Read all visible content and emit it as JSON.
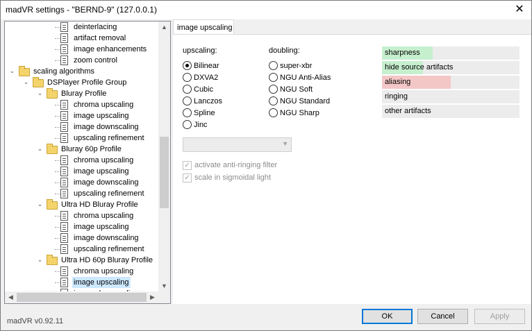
{
  "window": {
    "title": "madVR settings - \"BERND-9\" (127.0.0.1)"
  },
  "tree": {
    "items": [
      {
        "label": "deinterlacing",
        "level": 4,
        "kind": "page"
      },
      {
        "label": "artifact removal",
        "level": 4,
        "kind": "page"
      },
      {
        "label": "image enhancements",
        "level": 4,
        "kind": "page"
      },
      {
        "label": "zoom control",
        "level": 4,
        "kind": "page"
      },
      {
        "label": "scaling algorithms",
        "level": 1,
        "kind": "folder"
      },
      {
        "label": "DSPlayer Profile Group",
        "level": 2,
        "kind": "folder"
      },
      {
        "label": "Bluray Profile",
        "level": 3,
        "kind": "folder"
      },
      {
        "label": "chroma upscaling",
        "level": 4,
        "kind": "page"
      },
      {
        "label": "image upscaling",
        "level": 4,
        "kind": "page"
      },
      {
        "label": "image downscaling",
        "level": 4,
        "kind": "page"
      },
      {
        "label": "upscaling refinement",
        "level": 4,
        "kind": "page"
      },
      {
        "label": "Bluray 60p Profile",
        "level": 3,
        "kind": "folder"
      },
      {
        "label": "chroma upscaling",
        "level": 4,
        "kind": "page"
      },
      {
        "label": "image upscaling",
        "level": 4,
        "kind": "page"
      },
      {
        "label": "image downscaling",
        "level": 4,
        "kind": "page"
      },
      {
        "label": "upscaling refinement",
        "level": 4,
        "kind": "page"
      },
      {
        "label": "Ultra HD Bluray Profile",
        "level": 3,
        "kind": "folder"
      },
      {
        "label": "chroma upscaling",
        "level": 4,
        "kind": "page"
      },
      {
        "label": "image upscaling",
        "level": 4,
        "kind": "page"
      },
      {
        "label": "image downscaling",
        "level": 4,
        "kind": "page"
      },
      {
        "label": "upscaling refinement",
        "level": 4,
        "kind": "page"
      },
      {
        "label": "Ultra HD 60p Bluray Profile",
        "level": 3,
        "kind": "folder"
      },
      {
        "label": "chroma upscaling",
        "level": 4,
        "kind": "page"
      },
      {
        "label": "image upscaling",
        "level": 4,
        "kind": "page",
        "selected": true
      },
      {
        "label": "image downscaling",
        "level": 4,
        "kind": "page"
      }
    ]
  },
  "tab": {
    "label": "image upscaling"
  },
  "upscaling": {
    "label": "upscaling:",
    "options": [
      "Bilinear",
      "DXVA2",
      "Cubic",
      "Lanczos",
      "Spline",
      "Jinc"
    ],
    "selected": "Bilinear"
  },
  "doubling": {
    "label": "doubling:",
    "options": [
      "super-xbr",
      "NGU Anti-Alias",
      "NGU Soft",
      "NGU Standard",
      "NGU Sharp"
    ]
  },
  "filter_combo": {
    "value": ""
  },
  "checkboxes": {
    "anti_ringing": {
      "label": "activate anti-ringing filter",
      "checked": true,
      "enabled": false
    },
    "sigmoidal": {
      "label": "scale in sigmoidal light",
      "checked": true,
      "enabled": false
    }
  },
  "quality_bars": [
    {
      "label": "sharpness",
      "level": 0.37,
      "color": "#c6efce"
    },
    {
      "label": "hide source artifacts",
      "level": 0.3,
      "color": "#c6efce"
    },
    {
      "label": "aliasing",
      "level": 0.5,
      "color": "#f4c7c7"
    },
    {
      "label": "ringing",
      "level": 0,
      "color": "#c6efce"
    },
    {
      "label": "other artifacts",
      "level": 0,
      "color": "#c6efce"
    }
  ],
  "footer": {
    "version": "madVR v0.92.11",
    "ok": "OK",
    "cancel": "Cancel",
    "apply": "Apply"
  }
}
